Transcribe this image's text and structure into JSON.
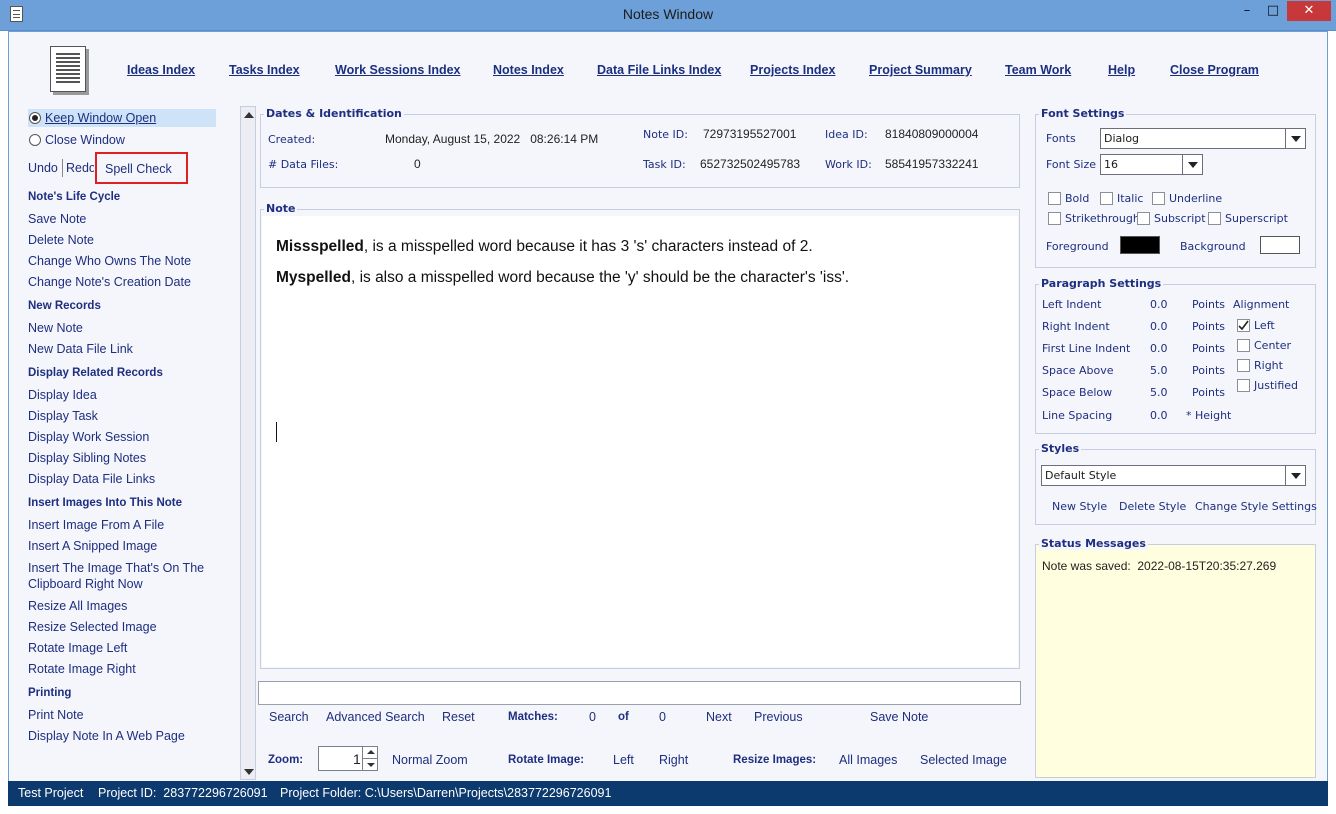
{
  "window": {
    "title": "Notes Window",
    "minimize": "–",
    "maximize": "□",
    "close": "✕"
  },
  "nav": [
    "Ideas Index",
    "Tasks Index",
    "Work Sessions Index",
    "Notes Index",
    "Data File Links Index",
    "Projects Index",
    "Project Summary",
    "Team Work",
    "Help",
    "Close Program"
  ],
  "sidebar": {
    "keep_open": "Keep Window Open",
    "close_window": "Close Window",
    "undo": "Undo",
    "redo": "Redo",
    "spell_check": "Spell Check",
    "sections": [
      {
        "header": "Note's Life Cycle",
        "items": [
          "Save Note",
          "Delete Note",
          "Change Who Owns The Note",
          "Change Note's Creation Date"
        ]
      },
      {
        "header": "New Records",
        "items": [
          "New Note",
          "New Data File Link"
        ]
      },
      {
        "header": "Display Related Records",
        "items": [
          "Display Idea",
          "Display Task",
          "Display Work Session",
          "Display Sibling Notes",
          "Display Data File Links"
        ]
      },
      {
        "header": "Insert Images Into This Note",
        "items": [
          "Insert Image From A File",
          "Insert A Snipped Image",
          "Insert The Image That's On The",
          "Clipboard Right Now",
          "Resize All Images",
          "Resize Selected Image",
          "Rotate Image Left",
          "Rotate Image Right"
        ]
      },
      {
        "header": "Printing",
        "items": [
          "Print Note",
          "Display Note In A Web Page"
        ]
      }
    ]
  },
  "dates": {
    "title": "Dates & Identification",
    "created_label": "Created:",
    "created_value": "Monday, August 15, 2022   08:26:14 PM",
    "data_files_label": "# Data Files:",
    "data_files_value": "0",
    "note_id_label": "Note ID:",
    "note_id_value": "72973195527001",
    "task_id_label": "Task ID:",
    "task_id_value": "652732502495783",
    "idea_id_label": "Idea ID:",
    "idea_id_value": "81840809000004",
    "work_id_label": "Work ID:",
    "work_id_value": "58541957332241"
  },
  "note": {
    "title": "Note",
    "line1_bold": "Missspelled",
    "line1_rest": ", is a misspelled word because it has 3 's' characters instead of 2.",
    "line2_bold": "Myspelled",
    "line2_rest": ", is also a misspelled word because the 'y' should be the character's 'iss'."
  },
  "search": {
    "placeholder": "",
    "search": "Search",
    "advanced": "Advanced Search",
    "reset": "Reset",
    "matches_label": "Matches:",
    "matches_value": "0",
    "of_label": "of",
    "of_value": "0",
    "next": "Next",
    "previous": "Previous",
    "save_note": "Save Note"
  },
  "zoom": {
    "label": "Zoom:",
    "value": "1",
    "normal": "Normal Zoom",
    "rotate_label": "Rotate Image:",
    "left": "Left",
    "right": "Right",
    "resize_label": "Resize Images:",
    "all": "All Images",
    "selected": "Selected Image"
  },
  "font_settings": {
    "title": "Font Settings",
    "fonts_label": "Fonts",
    "font_value": "Dialog",
    "size_label": "Font Size",
    "size_value": "16",
    "bold": "Bold",
    "italic": "Italic",
    "underline": "Underline",
    "strikethrough": "Strikethrough",
    "subscript": "Subscript",
    "superscript": "Superscript",
    "foreground": "Foreground",
    "background": "Background",
    "fg_color": "#000000",
    "bg_color": "#ffffff"
  },
  "paragraph": {
    "title": "Paragraph Settings",
    "rows": [
      {
        "label": "Left Indent",
        "value": "0.0",
        "unit": "Points"
      },
      {
        "label": "Right Indent",
        "value": "0.0",
        "unit": "Points"
      },
      {
        "label": "First Line Indent",
        "value": "0.0",
        "unit": "Points"
      },
      {
        "label": "Space Above",
        "value": "5.0",
        "unit": "Points"
      },
      {
        "label": "Space Below",
        "value": "5.0",
        "unit": "Points"
      },
      {
        "label": "Line Spacing",
        "value": "0.0",
        "unit": "* Height"
      }
    ],
    "alignment_label": "Alignment",
    "alignments": [
      "Left",
      "Center",
      "Right",
      "Justified"
    ],
    "checked_alignment": "Left"
  },
  "styles": {
    "title": "Styles",
    "value": "Default Style",
    "new": "New Style",
    "delete": "Delete Style",
    "change": "Change Style Settings"
  },
  "status": {
    "title": "Status Messages",
    "message": "Note was saved:  2022-08-15T20:35:27.269",
    "bg_color": "#ffffe0"
  },
  "statusbar": {
    "project": "Test Project",
    "project_id": "Project ID:  283772296726091",
    "folder": "Project Folder: C:\\Users\\Darren\\Projects\\283772296726091"
  },
  "accent": {
    "highlight_border": "#e02020",
    "selection_bg": "#cfe3f8"
  }
}
